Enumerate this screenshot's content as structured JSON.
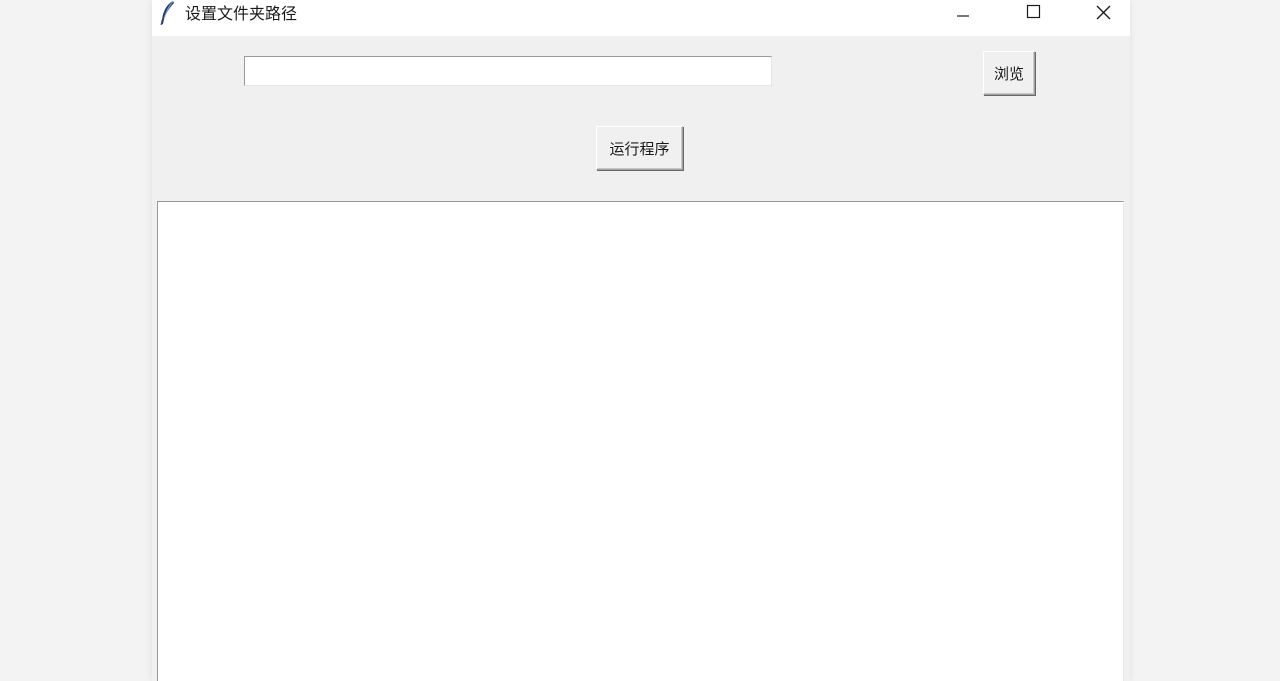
{
  "window": {
    "title": "设置文件夹路径",
    "icon": "feather-icon",
    "controls": {
      "minimize": "minimize-icon",
      "maximize": "maximize-icon",
      "close": "close-icon"
    }
  },
  "form": {
    "path_value": "",
    "path_placeholder": "",
    "browse_label": "浏览",
    "run_label": "运行程序"
  },
  "output": {
    "text": ""
  }
}
